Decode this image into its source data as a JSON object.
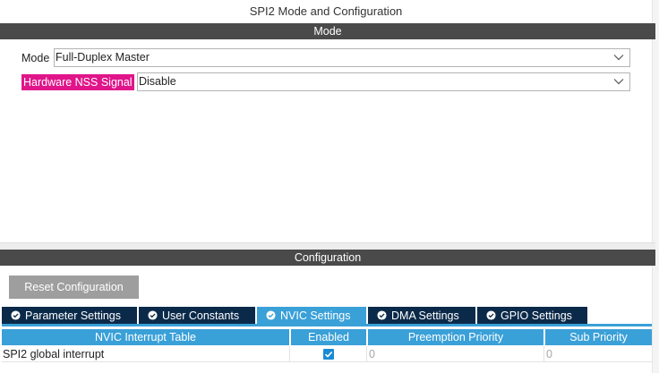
{
  "window": {
    "title": "SPI2 Mode and Configuration"
  },
  "colors": {
    "section_bar": "#4a4a4a",
    "highlight_label": "#e0158a",
    "button_gray": "#9e9e9e",
    "tab_dark": "#0b2a4a",
    "tab_active": "#3aa0d8",
    "table_header": "#3aa0d8",
    "check_blue": "#1a8ad3"
  },
  "mode_section": {
    "header": "Mode",
    "mode_label": "Mode",
    "mode_value": "Full-Duplex Master",
    "nss_label": "Hardware NSS Signal",
    "nss_value": "Disable"
  },
  "config_section": {
    "header": "Configuration",
    "reset_button": "Reset Configuration",
    "tabs": [
      {
        "label": "Parameter Settings",
        "icon": "check-circle-icon",
        "active": false
      },
      {
        "label": "User Constants",
        "icon": "check-circle-icon",
        "active": false
      },
      {
        "label": "NVIC Settings",
        "icon": "check-circle-icon",
        "active": true
      },
      {
        "label": "DMA Settings",
        "icon": "check-circle-icon",
        "active": false
      },
      {
        "label": "GPIO Settings",
        "icon": "check-circle-icon",
        "active": false
      }
    ],
    "nvic_table": {
      "columns": [
        "NVIC Interrupt Table",
        "Enabled",
        "Preemption Priority",
        "Sub Priority"
      ],
      "rows": [
        {
          "name": "SPI2 global interrupt",
          "enabled": true,
          "preemption_priority": "0",
          "sub_priority": "0"
        }
      ]
    }
  }
}
